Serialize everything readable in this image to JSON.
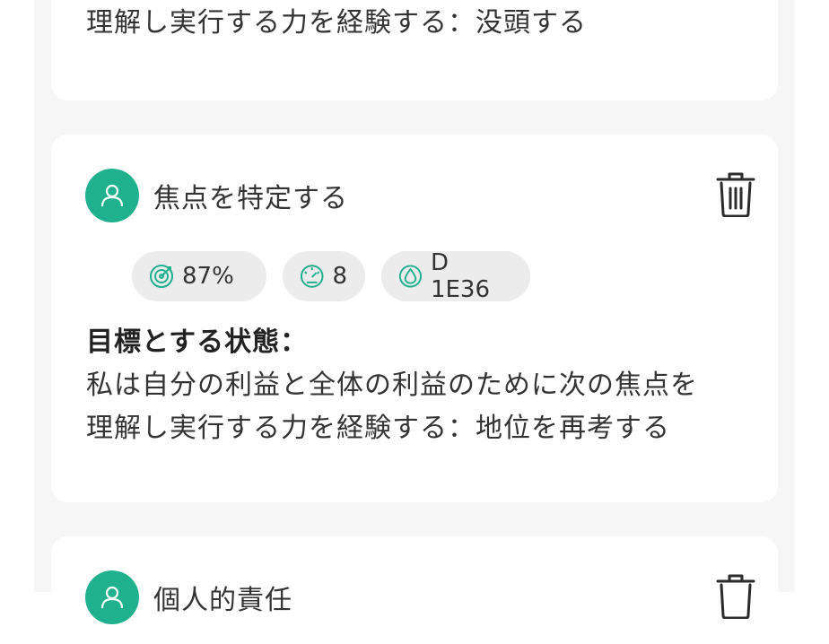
{
  "cards": [
    {
      "body_lines": [
        "理解し実行する力を経験する：没頭する"
      ]
    },
    {
      "title": "焦点を特定する",
      "chips": [
        {
          "icon": "target-icon",
          "label": "87%"
        },
        {
          "icon": "gauge-icon",
          "label": "8"
        },
        {
          "icon": "droplet-icon",
          "label": "D 1E36"
        }
      ],
      "state_label": "目標とする状態：",
      "body_lines": [
        "私は自分の利益と全体の利益のために次の焦点を",
        "理解し実行する力を経験する：地位を再考する"
      ]
    },
    {
      "title": "個人的責任"
    }
  ],
  "colors": {
    "accent": "#1fb08e",
    "chip_bg": "#ececec",
    "page_bg": "#f6f6f6"
  }
}
